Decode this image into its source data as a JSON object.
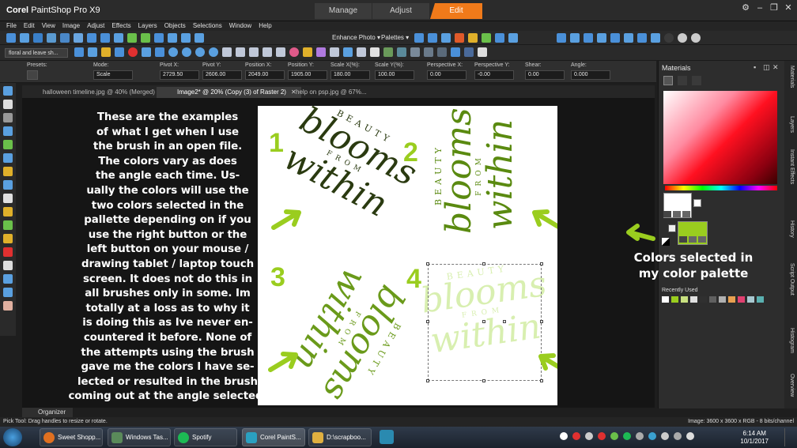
{
  "app": {
    "title_brand": "Corel",
    "title_rest": "PaintShop Pro X9",
    "workspace_tabs": [
      "Manage",
      "Adjust",
      "Edit"
    ]
  },
  "menu": [
    "File",
    "Edit",
    "View",
    "Image",
    "Adjust",
    "Effects",
    "Layers",
    "Objects",
    "Selections",
    "Window",
    "Help"
  ],
  "toolbar": {
    "enhance_photo": "Enhance Photo",
    "palettes": "Palettes",
    "brush_preset": "floral and leave sh..."
  },
  "tool_options": {
    "presets_label": "Presets:",
    "mode_label": "Mode:",
    "mode_value": "Scale",
    "fields": [
      {
        "label": "Pivot X:",
        "value": "2729.50"
      },
      {
        "label": "Pivot Y:",
        "value": "2606.00"
      },
      {
        "label": "Position X:",
        "value": "2049.00"
      },
      {
        "label": "Position Y:",
        "value": "1905.00"
      },
      {
        "label": "Scale X(%):",
        "value": "180.00"
      },
      {
        "label": "Scale Y(%):",
        "value": "100.00"
      },
      {
        "label": "Perspective X:",
        "value": "0.00"
      },
      {
        "label": "Perspective Y:",
        "value": "-0.00"
      },
      {
        "label": "Shear:",
        "value": "0.00"
      },
      {
        "label": "Angle:",
        "value": "0.000"
      }
    ]
  },
  "doc_tabs": [
    {
      "label": "halloween timeline.jpg @ 40% (Merged)"
    },
    {
      "label": "Image2* @ 20% (Copy (3) of Raster 2)"
    },
    {
      "label": "help on psp.jpg @ 67%..."
    }
  ],
  "annotation_text": "These are the examples of what I get when I use the brush in an open file. The colors vary as does the angle each time. Usually the colors will use the two colors selected in the pallette depending on if you use the right button or the left button on your mouse / drawing tablet / laptop touch screen. It does not do this in all brushes only in some. Im totally at a loss as to why it is doing this as Ive never encountered it before. None of the attempts using the brush gave me the colors I have selected or resulted in the brush coming out at the angle selected.",
  "annotation_lines": [
    "These are the examples",
    "of what I get when I use",
    "the brush in an open file.",
    "The colors vary as does",
    "the angle each time. Us-",
    "ually the colors will use the",
    "two colors selected in the",
    "pallette depending on if you",
    "use the right button or the",
    "left button on your mouse /",
    "drawing tablet / laptop touch",
    "screen. It does not do this in",
    "all brushes only in some. Im",
    "totally at a loss as to why it",
    "is doing this as Ive never en-",
    "countered it before. None of",
    "the attempts using the brush",
    "gave me the colors I have se-",
    "lected or resulted in the brush",
    "coming out at the angle selected."
  ],
  "canvas": {
    "numbers": [
      "1",
      "2",
      "3",
      "4"
    ],
    "art": {
      "beauty": "BEAUTY",
      "blooms": "blooms",
      "from": "FROM",
      "within": "within"
    },
    "colors": {
      "sample1": "#2a3a10",
      "sample2": "#5a8a10",
      "sample3": "#6a9a1a",
      "sample4": "#d8efb0",
      "accent": "#9acd1f"
    }
  },
  "color_info_lines": [
    "Colors selected in",
    "my color palette"
  ],
  "materials": {
    "title": "Materials",
    "recently_used": "Recently Used",
    "foreground": "#ffffff",
    "background": "#9acd1f",
    "recent_colors": [
      "#ffffff",
      "#9acd1f",
      "#c8e080",
      "#e0e0e0",
      "#303030",
      "#606060",
      "#b0b0b0",
      "#e8a050",
      "#e04070",
      "#a8c8d0",
      "#5ab0b0"
    ]
  },
  "side_tabs": [
    "Materials",
    "Layers",
    "Instant Effects",
    "History",
    "Script Output",
    "Histogram",
    "Overview"
  ],
  "organizer_label": "Organizer",
  "status": {
    "left": "Pick Tool: Drag handles to resize or rotate.",
    "right": "Image: 3600 x 3600 x RGB - 8 bits/channel"
  },
  "taskbar": {
    "tasks": [
      "Sweet Shopp...",
      "Windows Tas...",
      "Spotify",
      "Corel PaintS...",
      "D:\\scrapboo..."
    ],
    "time": "6:14 AM",
    "date": "10/1/2017"
  }
}
